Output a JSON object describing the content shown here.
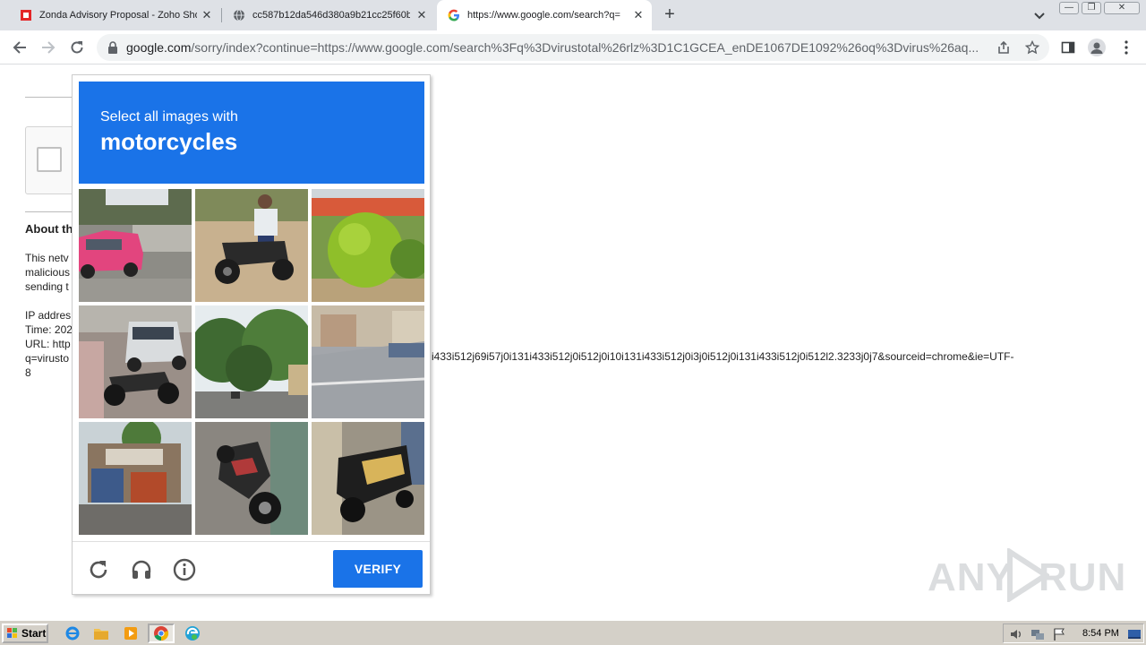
{
  "browser": {
    "tabs": [
      {
        "title": "Zonda Advisory Proposal - Zoho Sho",
        "favicon": "zoho-show-icon"
      },
      {
        "title": "cc587b12da546d380a9b21cc25f60b",
        "favicon": "globe-icon"
      },
      {
        "title": "https://www.google.com/search?q=",
        "favicon": "google-g-icon",
        "active": true
      }
    ],
    "url_host": "google.com",
    "url_rest": "/sorry/index?continue=https://www.google.com/search%3Fq%3Dvirustotal%26rlz%3D1C1GCEA_enDE1067DE1092%26oq%3Dvirus%26aq..."
  },
  "page": {
    "about_heading": "About th",
    "para_lines": [
      "This netv",
      "malicious",
      "sending t"
    ],
    "info_lines": [
      "IP addres",
      "Time: 202",
      "URL: http",
      "q=virusto",
      "8"
    ],
    "url_continuation": "i433i512j69i57j0i131i433i512j0i512j0i10i131i433i512j0i3j0i512j0i131i433i512j0i512l2.3233j0j7&sourceid=chrome&ie=UTF-"
  },
  "captcha": {
    "instruction": "Select all images with",
    "target": "motorcycles",
    "verify_label": "VERIFY",
    "tiles": [
      {
        "scene": "pink taxi car"
      },
      {
        "scene": "man on motorcycle"
      },
      {
        "scene": "green shrub"
      },
      {
        "scene": "parked motorcycle by car"
      },
      {
        "scene": "trees on street"
      },
      {
        "scene": "street crossing"
      },
      {
        "scene": "roadside shop"
      },
      {
        "scene": "parked scooter"
      },
      {
        "scene": "yellow scooter"
      }
    ]
  },
  "watermark": {
    "left": "ANY",
    "right": "RUN"
  },
  "taskbar": {
    "start_label": "Start",
    "clock": "8:54 PM"
  },
  "colors": {
    "accent": "#1a73e8",
    "tabstrip": "#dee1e6",
    "taskbar": "#d4d0c8"
  }
}
